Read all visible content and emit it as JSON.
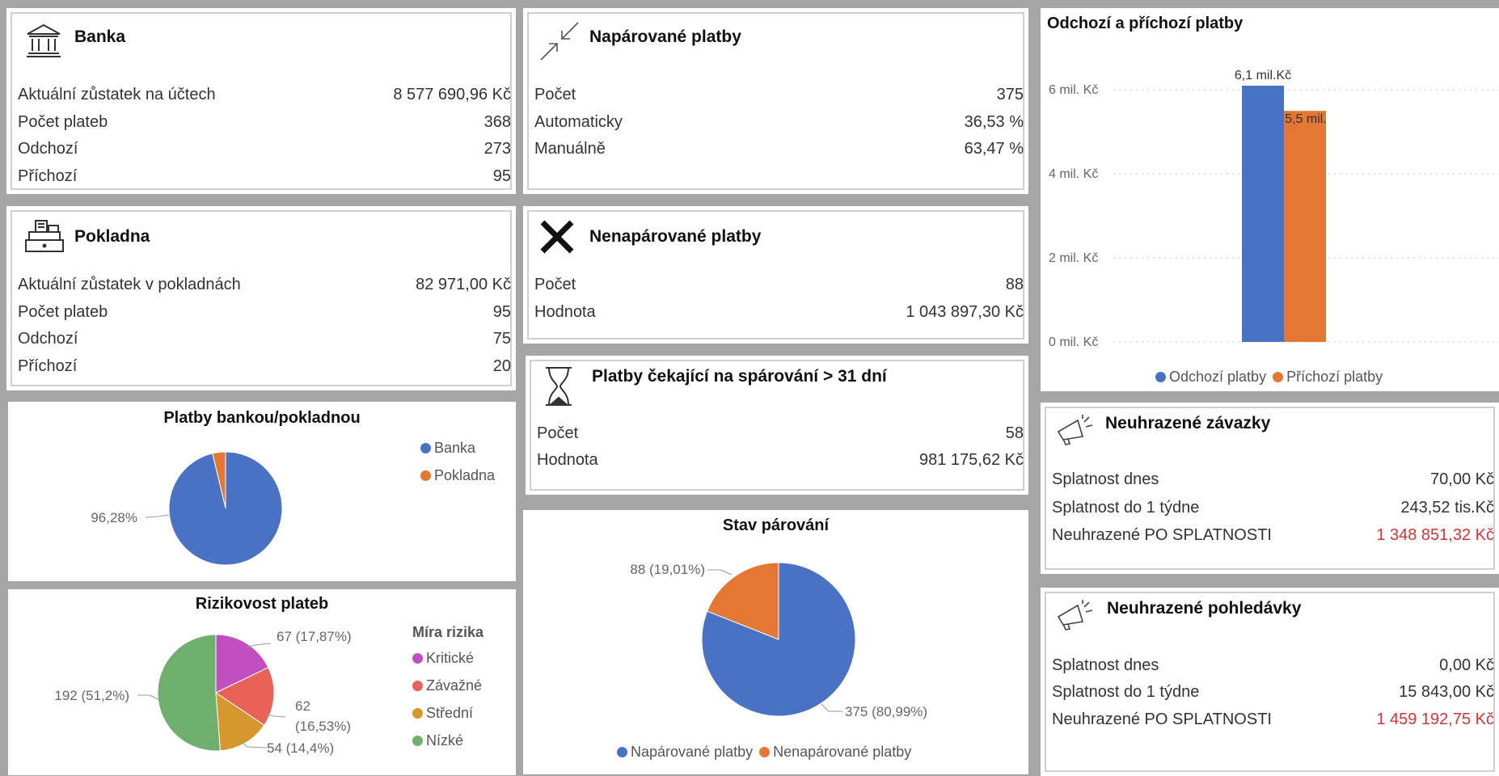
{
  "bank": {
    "title": "Banka",
    "rows": [
      {
        "label": "Aktuální zůstatek na účtech",
        "value": "8 577 690,96 Kč"
      },
      {
        "label": "Počet plateb",
        "value": "368"
      },
      {
        "label": "Odchozí",
        "value": "273"
      },
      {
        "label": "Příchozí",
        "value": "95"
      }
    ]
  },
  "cash": {
    "title": "Pokladna",
    "rows": [
      {
        "label": "Aktuální zůstatek v pokladnách",
        "value": "82 971,00 Kč"
      },
      {
        "label": "Počet plateb",
        "value": "95"
      },
      {
        "label": "Odchozí",
        "value": "75"
      },
      {
        "label": "Příchozí",
        "value": "20"
      }
    ]
  },
  "paired": {
    "title": "Napárované platby",
    "rows": [
      {
        "label": "Počet",
        "value": "375"
      },
      {
        "label": "Automaticky",
        "value": "36,53 %"
      },
      {
        "label": "Manuálně",
        "value": "63,47 %"
      }
    ]
  },
  "unpaired": {
    "title": "Nenapárované platby",
    "rows": [
      {
        "label": "Počet",
        "value": "88"
      },
      {
        "label": "Hodnota",
        "value": "1 043 897,30 Kč"
      }
    ]
  },
  "waiting": {
    "title": "Platby čekající na spárování > 31 dní",
    "rows": [
      {
        "label": "Počet",
        "value": "58"
      },
      {
        "label": "Hodnota",
        "value": "981 175,62 Kč"
      }
    ]
  },
  "liabilities": {
    "title": "Neuhrazené závazky",
    "rows": [
      {
        "label": "Splatnost dnes",
        "value": "70,00 Kč"
      },
      {
        "label": "Splatnost do 1 týdne",
        "value": "243,52 tis.Kč"
      },
      {
        "label": "Neuhrazené PO SPLATNOSTI",
        "value": "1 348 851,32 Kč"
      }
    ]
  },
  "receivables": {
    "title": "Neuhrazené pohledávky",
    "rows": [
      {
        "label": "Splatnost dnes",
        "value": "0,00 Kč"
      },
      {
        "label": "Splatnost do 1 týdne",
        "value": "15 843,00 Kč"
      },
      {
        "label": "Neuhrazené PO SPLATNOSTI",
        "value": "1 459 192,75 Kč"
      }
    ]
  },
  "colors": {
    "blue": "#4a72c4",
    "orange": "#e37733",
    "magenta": "#c24fc0",
    "red": "#ea6157",
    "gold": "#d6972e",
    "green": "#6faf6d",
    "overdue_text": "#d13438"
  },
  "icons": {
    "bank": "bank-building-icon",
    "cash": "cash-register-icon",
    "paired": "arrows-inward-icon",
    "unpaired": "x-cross-icon",
    "waiting": "hourglass-icon",
    "liabilities": "megaphone-icon",
    "receivables": "megaphone-icon"
  },
  "chart_data": [
    {
      "id": "bank-cash",
      "type": "pie",
      "title": "Platby bankou/pokladnou",
      "categories": [
        "Banka",
        "Pokladna"
      ],
      "values": [
        96.28,
        3.72
      ],
      "data_labels": [
        "96,28%"
      ],
      "legend": "right"
    },
    {
      "id": "risk",
      "type": "pie",
      "title": "Rizikovost plateb",
      "legend_title": "Míra rizika",
      "categories": [
        "Kritické",
        "Závažné",
        "Střední",
        "Nízké"
      ],
      "values": [
        67,
        62,
        54,
        192
      ],
      "data_labels": [
        "67 (17,87%)",
        "62",
        "(16,53%)",
        "54 (14,4%)",
        "192 (51,2%)"
      ],
      "legend": "right"
    },
    {
      "id": "pairing",
      "type": "pie",
      "title": "Stav párování",
      "categories": [
        "Napárované platby",
        "Nenapárované platby"
      ],
      "values": [
        375,
        88
      ],
      "data_labels": [
        "375 (80,99%)",
        "88 (19,01%)"
      ],
      "legend": "bottom"
    },
    {
      "id": "flows",
      "type": "bar",
      "title": "Odchozí a příchozí platby",
      "series": [
        {
          "name": "Odchozí platby",
          "values": [
            6.1
          ]
        },
        {
          "name": "Příchozí platby",
          "values": [
            5.5
          ]
        }
      ],
      "data_labels": [
        "6,1 mil.Kč",
        "5,5 mil."
      ],
      "ytick_labels": [
        "6 mil. Kč",
        "4 mil. Kč",
        "2 mil. Kč",
        "0 mil. Kč"
      ],
      "yticks": [
        6,
        4,
        2,
        0
      ],
      "ylim": [
        0,
        6.1
      ],
      "grid": true,
      "legend": "bottom"
    }
  ]
}
